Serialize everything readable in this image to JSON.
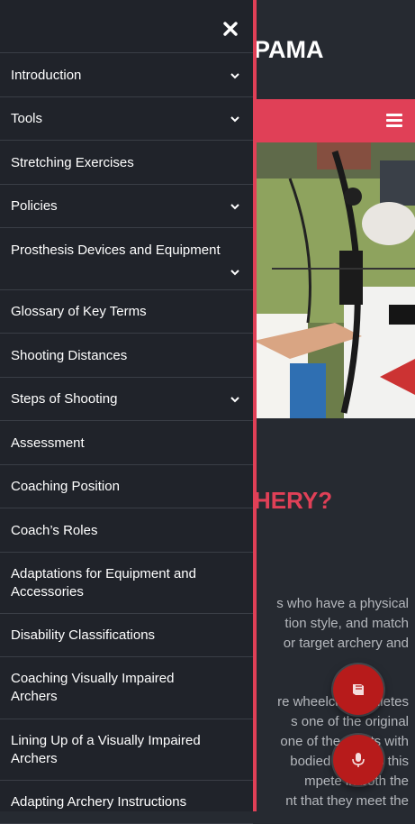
{
  "background": {
    "logo_text": "PAMA",
    "heading_fragment": "HERY?",
    "paragraph_one": [
      "s who have a physical",
      "tion style, and match",
      "or target archery and"
    ],
    "paragraph_two": [
      "re wheelchair athletes",
      "s one of the original",
      "one of the sports with",
      "bodied partners this",
      "mpete in both the",
      "nt that they meet the"
    ]
  },
  "drawer": {
    "menu": [
      {
        "label": "Introduction",
        "has_submenu": true
      },
      {
        "label": "Tools",
        "has_submenu": true
      },
      {
        "label": "Stretching Exercises",
        "has_submenu": false
      },
      {
        "label": "Policies",
        "has_submenu": true
      },
      {
        "label": "Prosthesis Devices and Equipment",
        "has_submenu": true
      },
      {
        "label": "Glossary of Key Terms",
        "has_submenu": false
      },
      {
        "label": "Shooting Distances",
        "has_submenu": false
      },
      {
        "label": "Steps of Shooting",
        "has_submenu": true
      },
      {
        "label": "Assessment",
        "has_submenu": false
      },
      {
        "label": "Coaching Position",
        "has_submenu": false
      },
      {
        "label": "Coach’s Roles",
        "has_submenu": false
      },
      {
        "label": "Adaptations for Equipment and Accessories",
        "has_submenu": false
      },
      {
        "label": "Disability Classifications",
        "has_submenu": false
      },
      {
        "label": "Coaching Visually Impaired Archers",
        "has_submenu": false
      },
      {
        "label": "Lining Up of a Visually Impaired Archers",
        "has_submenu": false
      },
      {
        "label": "Adapting Archery Instructions",
        "has_submenu": false
      }
    ]
  },
  "icons": {
    "close": "close-icon",
    "menu": "hamburger-icon",
    "chevron": "chevron-down-icon",
    "book": "book-icon",
    "mic": "microphone-icon"
  },
  "colors": {
    "accent": "#e04057",
    "drawer_bg": "#20232a",
    "page_bg": "#262a31",
    "fab": "#b71b1b"
  }
}
